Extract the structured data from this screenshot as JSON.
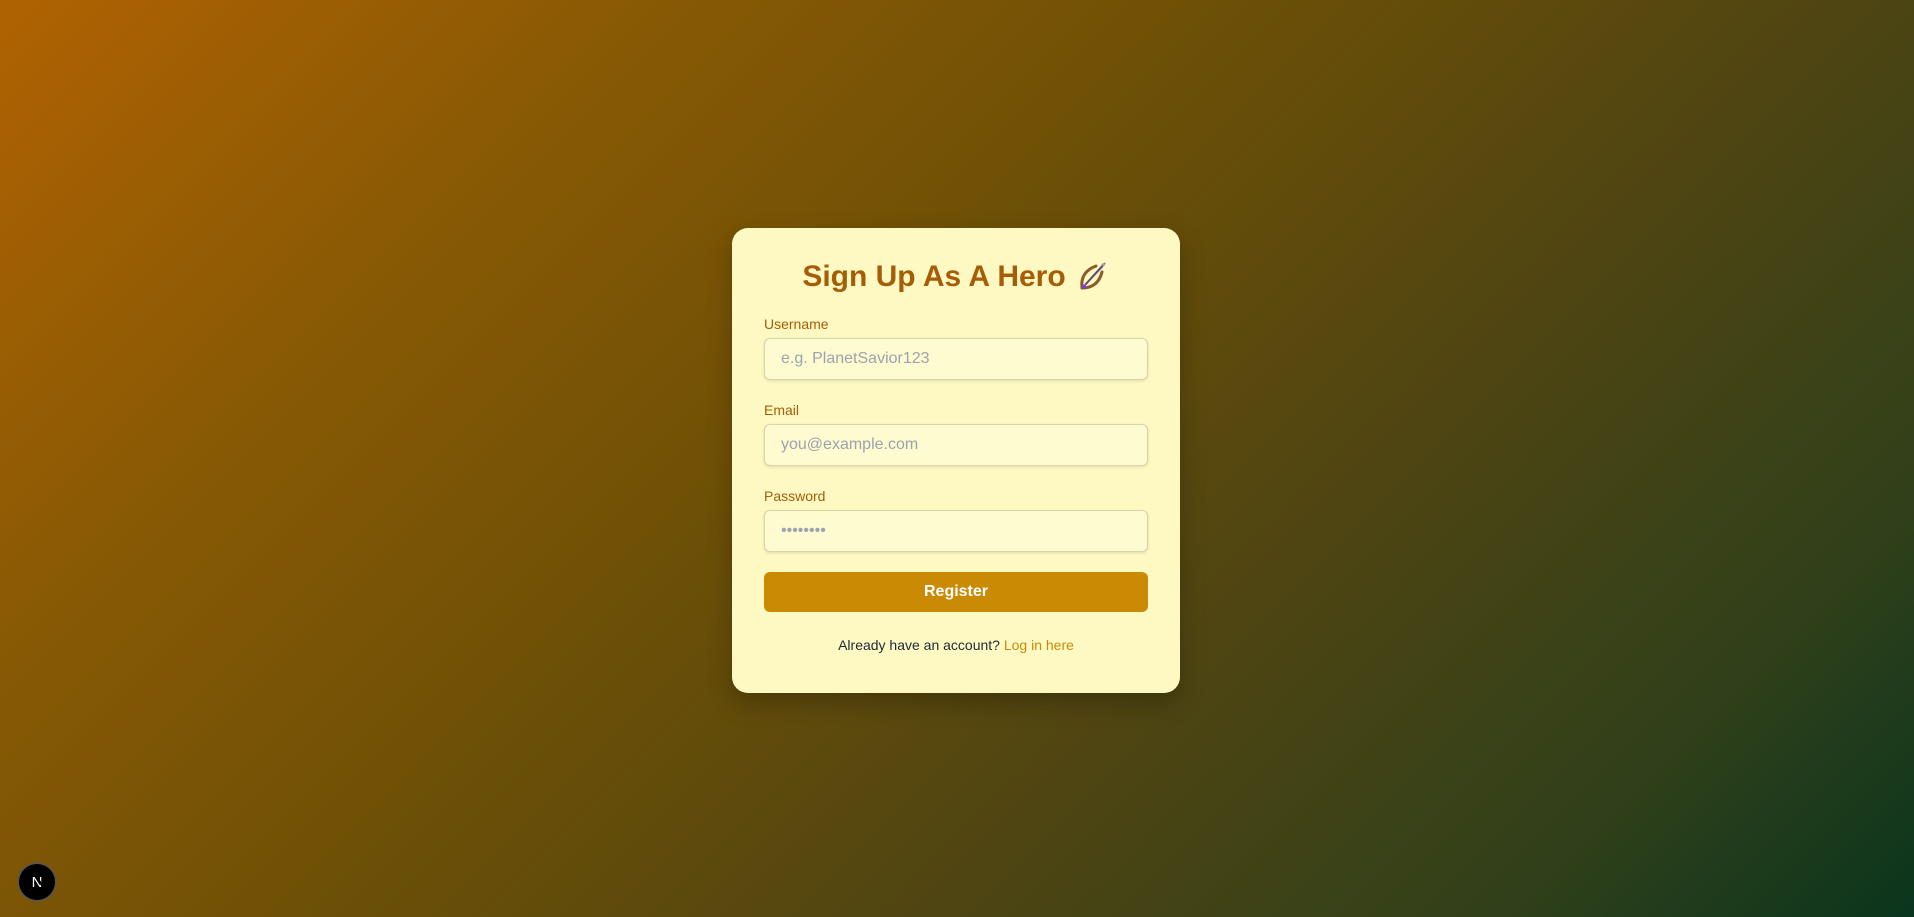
{
  "form": {
    "title": "Sign Up As A Hero",
    "title_icon": "bow-and-arrow-icon",
    "fields": [
      {
        "label": "Username",
        "placeholder": "e.g. PlanetSavior123",
        "value": ""
      },
      {
        "label": "Email",
        "placeholder": "you@example.com",
        "value": ""
      },
      {
        "label": "Password",
        "placeholder": "••••••••",
        "value": ""
      }
    ],
    "submit_label": "Register",
    "footer_text": "Already have an account?",
    "footer_link": "Log in here"
  },
  "badge": {
    "letter": "N",
    "icon": "nextjs-logo-icon"
  },
  "colors": {
    "card_background": "#fef9c3",
    "accent": "#ca8a04",
    "title": "#a55d07"
  }
}
